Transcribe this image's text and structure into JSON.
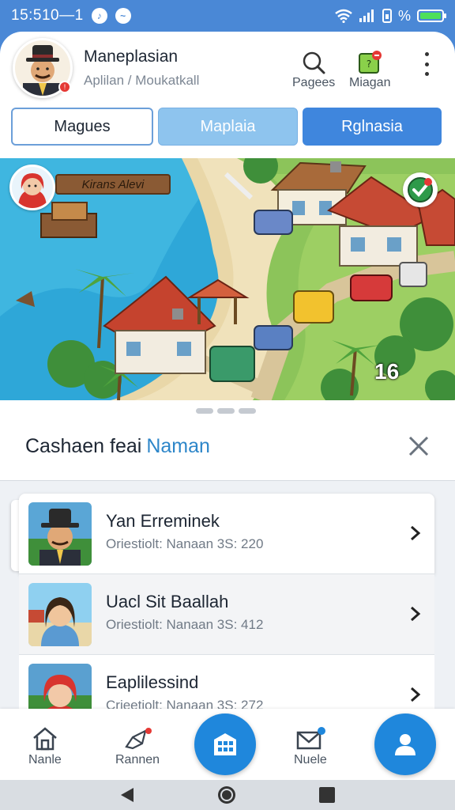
{
  "status_bar": {
    "time": "15:510—1",
    "battery_label": "%"
  },
  "header": {
    "user_name": "Maneplasian",
    "user_subtitle": "Aplilan / Moukatkall",
    "actions": [
      {
        "label": "Pagees",
        "icon": "search-icon"
      },
      {
        "label": "Miagan",
        "icon": "map-pin-icon"
      }
    ],
    "notification_count": "!"
  },
  "tabs": [
    {
      "label": "Magues",
      "active": true
    },
    {
      "label": "Maplaia",
      "active": false
    },
    {
      "label": "Rglnasia",
      "active": false
    }
  ],
  "map": {
    "sign_text": "Kirans Alevi",
    "count": "16"
  },
  "section": {
    "title": "Cashaen feai",
    "highlight": "Naman"
  },
  "list": [
    {
      "title": "Yan Erreminek",
      "subtitle": "Oriestiolt: Nanaan 3S: 220"
    },
    {
      "title": "Uacl Sit Baallah",
      "subtitle": "Oriestiolt: Nanaan 3S: 412"
    },
    {
      "title": "Eaplilessind",
      "subtitle": "Crieetiolt: Nanaan 3S: 272"
    }
  ],
  "bottom_nav": [
    {
      "label": "Nanle",
      "icon": "home-icon"
    },
    {
      "label": "Rannen",
      "icon": "rocket-icon"
    },
    {
      "label": "Nuele",
      "icon": "mail-icon"
    }
  ],
  "colors": {
    "primary": "#1f87dc",
    "status_bar": "#4a88d6",
    "highlight": "#2d86c9"
  }
}
